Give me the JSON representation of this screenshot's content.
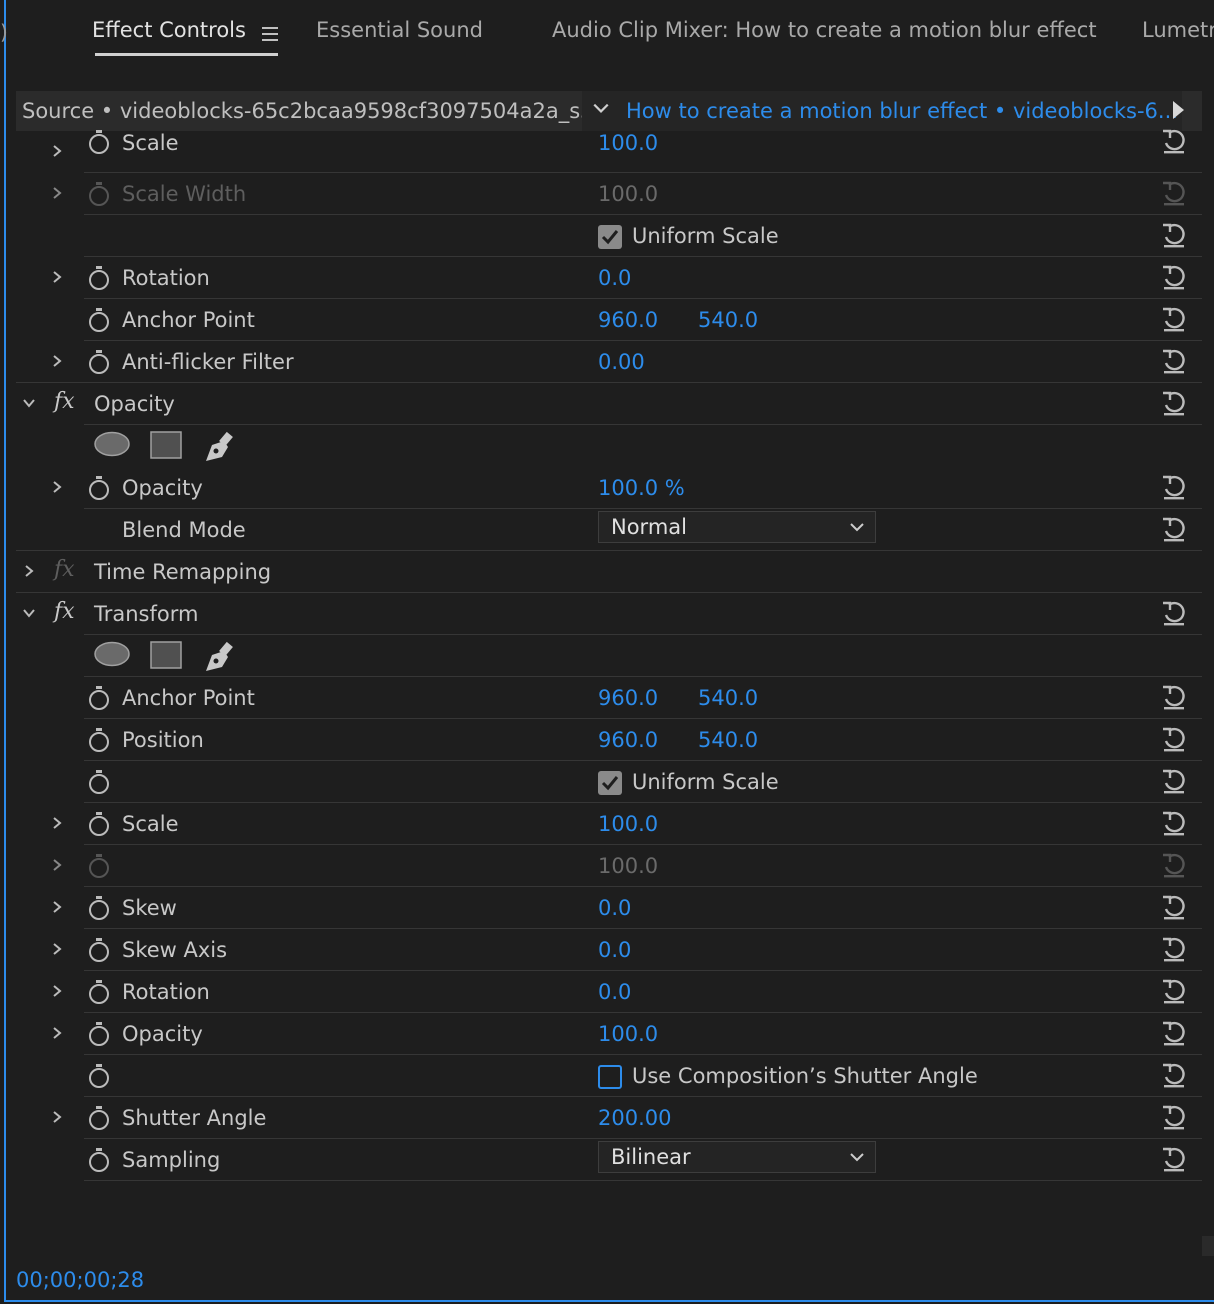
{
  "tabs": [
    {
      "label": "Effect Controls",
      "active": true
    },
    {
      "label": "Essential Sound"
    },
    {
      "label": "Audio Clip Mixer: How to create a motion blur effect"
    },
    {
      "label": "Lumetr"
    }
  ],
  "header": {
    "source": "Source • videoblocks-65c2bcaa9598cf3097504a2a_s3...",
    "sequence": "How to create a motion blur effect • videoblocks-6..."
  },
  "rows": {
    "scale": {
      "label": "Scale",
      "v1": "100.0"
    },
    "scale_width": {
      "label": "Scale Width",
      "v1": "100.0"
    },
    "uniform1": {
      "label": "Uniform Scale"
    },
    "rotation": {
      "label": "Rotation",
      "v1": "0.0"
    },
    "anchor": {
      "label": "Anchor Point",
      "v1": "960.0",
      "v2": "540.0"
    },
    "antiflicker": {
      "label": "Anti-flicker Filter",
      "v1": "0.00"
    },
    "opacity_group": {
      "label": "Opacity"
    },
    "opacity": {
      "label": "Opacity",
      "v1": "100.0 %"
    },
    "blend": {
      "label": "Blend Mode",
      "value": "Normal"
    },
    "time_remap": {
      "label": "Time Remapping"
    },
    "transform_group": {
      "label": "Transform"
    },
    "t_anchor": {
      "label": "Anchor Point",
      "v1": "960.0",
      "v2": "540.0"
    },
    "t_position": {
      "label": "Position",
      "v1": "960.0",
      "v2": "540.0"
    },
    "t_uniform": {
      "label": "Uniform Scale"
    },
    "t_scale": {
      "label": "Scale",
      "v1": "100.0"
    },
    "t_scale_w": {
      "v1": "100.0"
    },
    "t_skew": {
      "label": "Skew",
      "v1": "0.0"
    },
    "t_skew_axis": {
      "label": "Skew Axis",
      "v1": "0.0"
    },
    "t_rotation": {
      "label": "Rotation",
      "v1": "0.0"
    },
    "t_opacity": {
      "label": "Opacity",
      "v1": "100.0"
    },
    "t_comp_shutter": {
      "label": "Use Composition’s Shutter Angle"
    },
    "t_shutter": {
      "label": "Shutter Angle",
      "v1": "200.00"
    },
    "t_sampling": {
      "label": "Sampling",
      "value": "Bilinear"
    }
  },
  "timecode": "00;00;00;28",
  "colors": {
    "accent": "#2d8ceb",
    "panel": "#1e1e1e",
    "text": "#c8c8c8"
  }
}
